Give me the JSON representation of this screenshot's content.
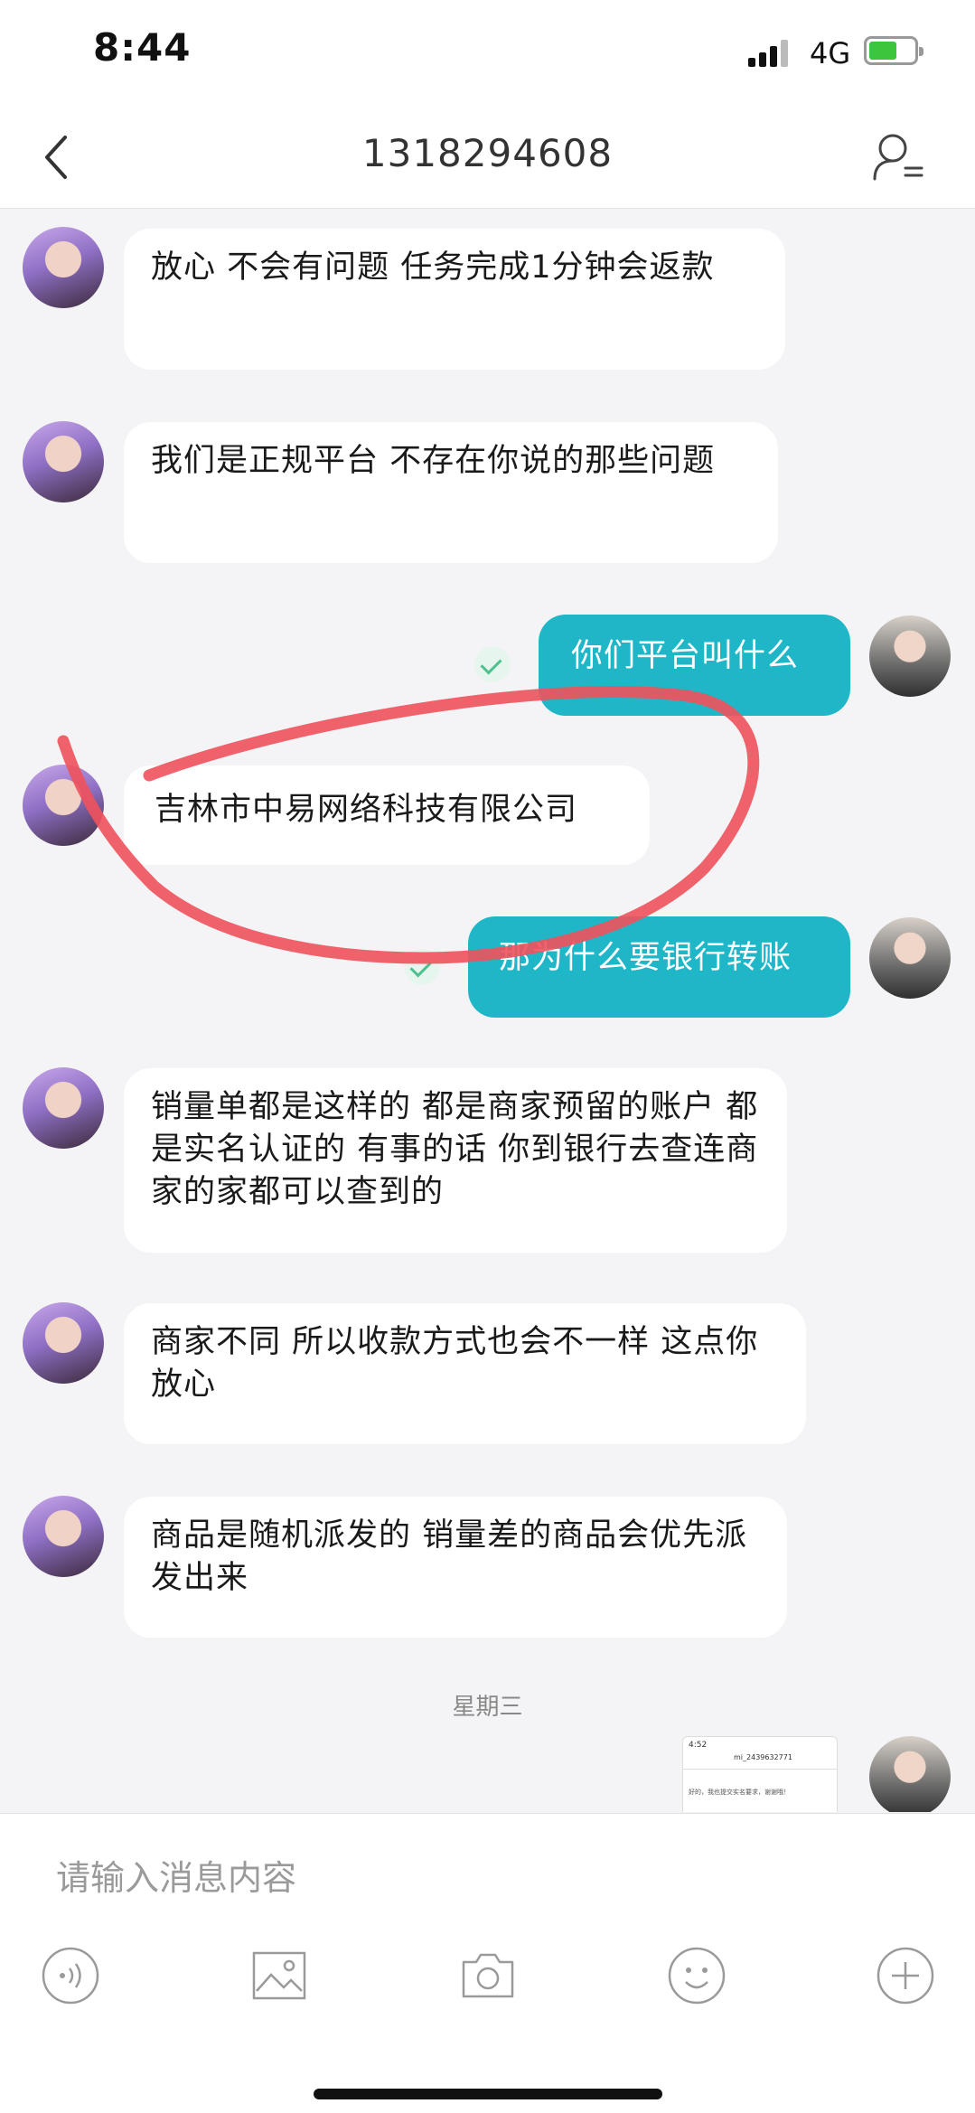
{
  "status_bar": {
    "time": "8:44",
    "network": "4G"
  },
  "header": {
    "title": "1318294608"
  },
  "messages": [
    {
      "side": "in",
      "text": "放心 不会有问题   任务完成1分钟会返款"
    },
    {
      "side": "in",
      "text": "我们是正规平台  不存在你说的那些问题"
    },
    {
      "side": "out",
      "text": "你们平台叫什么"
    },
    {
      "side": "in",
      "text": "吉林市中易网络科技有限公司"
    },
    {
      "side": "out",
      "text": "那为什么要银行转账"
    },
    {
      "side": "in",
      "text": "销量单都是这样的   都是商家预留的账户  都是实名认证的   有事的话 你到银行去查连商家的家都可以查到的"
    },
    {
      "side": "in",
      "text": "商家不同  所以收款方式也会不一样   这点你放心"
    },
    {
      "side": "in",
      "text": "商品是随机派发的   销量差的商品会优先派发出来"
    }
  ],
  "date_separator": "星期三",
  "image_message": {
    "time": "4:52",
    "title": "mi_2439632771",
    "text": "好的，我也提交实名要求，谢谢哦！"
  },
  "input": {
    "placeholder": "请输入消息内容"
  },
  "toolbar": [
    "voice-icon",
    "image-icon",
    "camera-icon",
    "emoji-icon",
    "plus-icon"
  ],
  "colors": {
    "outgoing_bubble": "#1fb7c8",
    "annotation_circle": "#f0525c"
  }
}
